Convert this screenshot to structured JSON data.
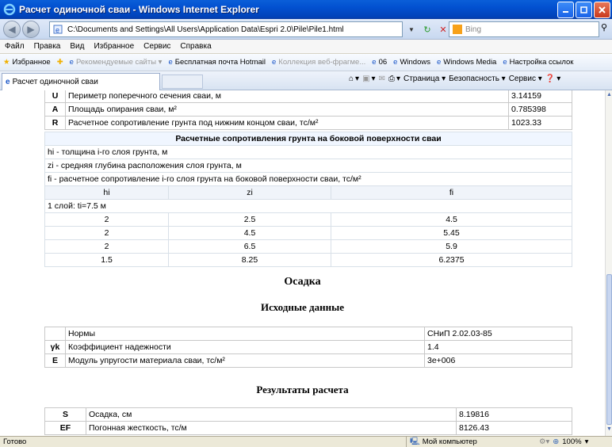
{
  "window": {
    "title": "Расчет одиночной сваи - Windows Internet Explorer"
  },
  "address": {
    "url": "C:\\Documents and Settings\\All Users\\Application Data\\Espri 2.0\\Pile\\Pile1.html"
  },
  "search": {
    "placeholder": "Bing"
  },
  "menu": [
    "Файл",
    "Правка",
    "Вид",
    "Избранное",
    "Сервис",
    "Справка"
  ],
  "favorites": {
    "label": "Избранное",
    "items": [
      "Рекомендуемые сайты ▾",
      "Бесплатная почта Hotmail",
      "Коллекция веб-фрагме...",
      "06",
      "Windows",
      "Windows Media",
      "Настройка ссылок"
    ]
  },
  "tab": {
    "label": "Расчет одиночной сваи"
  },
  "commands": {
    "page": "Страница ▾",
    "safety": "Безопасность ▾",
    "service": "Сервис ▾"
  },
  "top_table": [
    {
      "sym": "U",
      "desc": "Периметр поперечного сечения сваи, м",
      "value": "3.14159"
    },
    {
      "sym": "A",
      "desc": "Площадь опирания сваи, м²",
      "value": "0.785398"
    },
    {
      "sym": "R",
      "desc": "Расчетное сопротивление грунта под нижним концом сваи, тс/м²",
      "value": "1023.33"
    }
  ],
  "side_table": {
    "header": "Расчетные сопротивления грунта на боковой поверхности сваи",
    "notes": [
      "hi - толщина i-го слоя грунта, м",
      "zi - средняя глубина расположения слоя грунта, м",
      "fi - расчетное сопротивление i-го слоя грунта на боковой поверхности сваи, тс/м²"
    ],
    "columns": [
      "hi",
      "zi",
      "fi"
    ],
    "layer_label": "1 слой: ti=7.5 м",
    "rows": [
      [
        "2",
        "2.5",
        "4.5"
      ],
      [
        "2",
        "4.5",
        "5.45"
      ],
      [
        "2",
        "6.5",
        "5.9"
      ],
      [
        "1.5",
        "8.25",
        "6.2375"
      ]
    ]
  },
  "settlement": {
    "title": "Осадка",
    "input_title": "Исходные данные",
    "inputs": [
      {
        "sym": "",
        "desc": "Нормы",
        "value": "СНиП 2.02.03-85"
      },
      {
        "sym": "γk",
        "desc": "Коэффициент надежности",
        "value": "1.4"
      },
      {
        "sym": "E",
        "desc": "Модуль упругости материала сваи, тс/м²",
        "value": "3e+006"
      }
    ],
    "results_title": "Результаты расчета",
    "results": [
      {
        "sym": "S",
        "desc": "Осадка, см",
        "value": "8.19816"
      },
      {
        "sym": "EF",
        "desc": "Погонная жесткость, тс/м",
        "value": "8126.43"
      }
    ]
  },
  "status": {
    "text": "Готово",
    "zone": "Мой компьютер",
    "zoom": "100%"
  }
}
